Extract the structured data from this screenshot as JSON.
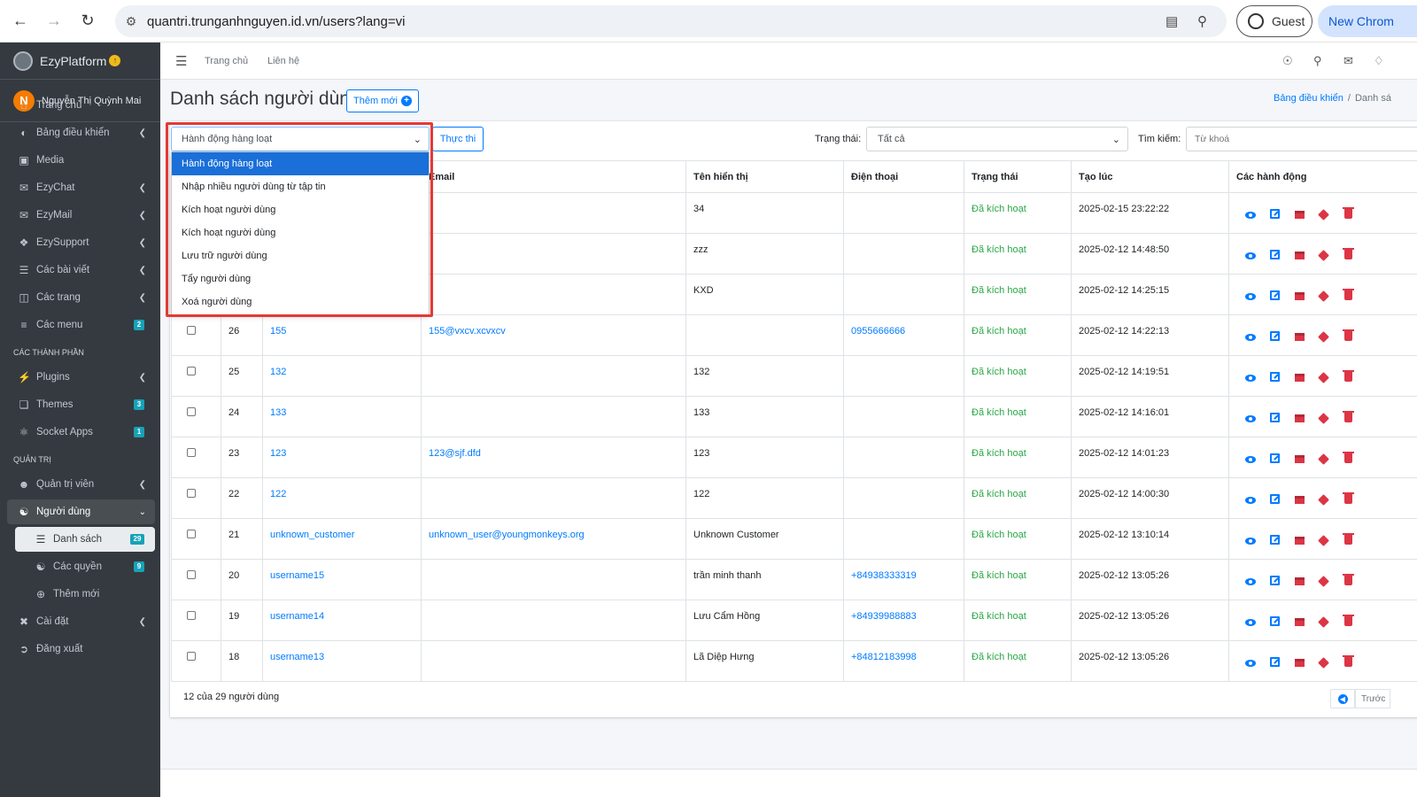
{
  "browser": {
    "url": "quantri.trunganhnguyen.id.vn/users?lang=vi",
    "guest_label": "Guest",
    "new_chrome_label": "New Chrom"
  },
  "sidebar": {
    "brand": "EzyPlatform",
    "user_initial": "N",
    "user_name": "Nguyễn Thị Quỳnh Mai",
    "items": [
      {
        "label": "Trang chủ",
        "icon": "home-icon"
      },
      {
        "label": "Bảng điều khiển",
        "icon": "dashboard-icon"
      },
      {
        "label": "Media",
        "icon": "media-icon"
      },
      {
        "label": "EzyChat",
        "icon": "chat-icon"
      },
      {
        "label": "EzyMail",
        "icon": "mail-icon"
      },
      {
        "label": "EzySupport",
        "icon": "support-icon"
      },
      {
        "label": "Các bài viết",
        "icon": "posts-icon"
      },
      {
        "label": "Các trang",
        "icon": "pages-icon"
      },
      {
        "label": "Các menu",
        "icon": "menu-icon",
        "badge": "2"
      }
    ],
    "header_components": "CÁC THÀNH PHẦN",
    "components": [
      {
        "label": "Plugins",
        "icon": "plugin-icon"
      },
      {
        "label": "Themes",
        "icon": "theme-icon",
        "badge": "3"
      },
      {
        "label": "Socket Apps",
        "icon": "socket-icon",
        "badge": "1"
      }
    ],
    "header_admin": "QUẢN TRỊ",
    "admin": [
      {
        "label": "Quản trị viên",
        "icon": "admin-icon"
      },
      {
        "label": "Người dùng",
        "icon": "users-icon"
      },
      {
        "label": "Danh sách",
        "icon": "list-icon",
        "badge": "29"
      },
      {
        "label": "Các quyền",
        "icon": "roles-icon",
        "badge": "9"
      },
      {
        "label": "Thêm mới",
        "icon": "plus-circle-icon"
      },
      {
        "label": "Cài đặt",
        "icon": "settings-icon"
      },
      {
        "label": "Đăng xuất",
        "icon": "logout-icon"
      }
    ]
  },
  "topnav": {
    "home": "Trang chủ",
    "contact": "Liên hệ"
  },
  "page": {
    "title": "Danh sách người dùng",
    "add_label": "Thêm mới",
    "breadcrumb_1": "Bảng điều khiển",
    "breadcrumb_2": "Danh sá"
  },
  "toolbar": {
    "bulk_value": "Hành động hàng loạt",
    "exec_label": "Thực thi",
    "status_label": "Trạng thái:",
    "status_value": "Tất cả",
    "search_label": "Tìm kiếm:",
    "search_placeholder": "Từ khoá"
  },
  "dropdown": {
    "options": [
      "Hành động hàng loạt",
      "Nhập nhiều người dùng từ tập tin",
      "Kích hoạt người dùng",
      "Kích hoạt người dùng",
      "Lưu trữ người dùng",
      "Tẩy người dùng",
      "Xoá người dùng"
    ]
  },
  "table": {
    "headers": [
      "",
      "",
      "",
      "Email",
      "Tên hiển thị",
      "Điện thoại",
      "Trạng thái",
      "Tạo lúc",
      "Các hành động"
    ],
    "rows": [
      {
        "id": "",
        "username": "",
        "email": "",
        "display": "34",
        "phone": "",
        "status": "Đã kích hoạt",
        "created": "2025-02-15 23:22:22"
      },
      {
        "id": "",
        "username": "",
        "email": "",
        "display": "zzz",
        "phone": "",
        "status": "Đã kích hoạt",
        "created": "2025-02-12 14:48:50"
      },
      {
        "id": "",
        "username": "",
        "email": "",
        "display": "KXD",
        "phone": "",
        "status": "Đã kích hoạt",
        "created": "2025-02-12 14:25:15"
      },
      {
        "id": "26",
        "username": "155",
        "email": "155@vxcv.xcvxcv",
        "display": "",
        "phone": "0955666666",
        "status": "Đã kích hoạt",
        "created": "2025-02-12 14:22:13"
      },
      {
        "id": "25",
        "username": "132",
        "email": "",
        "display": "132",
        "phone": "",
        "status": "Đã kích hoạt",
        "created": "2025-02-12 14:19:51"
      },
      {
        "id": "24",
        "username": "133",
        "email": "",
        "display": "133",
        "phone": "",
        "status": "Đã kích hoạt",
        "created": "2025-02-12 14:16:01"
      },
      {
        "id": "23",
        "username": "123",
        "email": "123@sjf.dfd",
        "display": "123",
        "phone": "",
        "status": "Đã kích hoạt",
        "created": "2025-02-12 14:01:23"
      },
      {
        "id": "22",
        "username": "122",
        "email": "",
        "display": "122",
        "phone": "",
        "status": "Đã kích hoạt",
        "created": "2025-02-12 14:00:30"
      },
      {
        "id": "21",
        "username": "unknown_customer",
        "email": "unknown_user@youngmonkeys.org",
        "display": "Unknown Customer",
        "phone": "",
        "status": "Đã kích hoạt",
        "created": "2025-02-12 13:10:14"
      },
      {
        "id": "20",
        "username": "username15",
        "email": "",
        "display": "trần minh thanh",
        "phone": "+84938333319",
        "status": "Đã kích hoạt",
        "created": "2025-02-12 13:05:26"
      },
      {
        "id": "19",
        "username": "username14",
        "email": "",
        "display": "Lưu Cẩm Hồng",
        "phone": "+84939988883",
        "status": "Đã kích hoạt",
        "created": "2025-02-12 13:05:26"
      },
      {
        "id": "18",
        "username": "username13",
        "email": "",
        "display": "Lã Diệp Hưng",
        "phone": "+84812183998",
        "status": "Đã kích hoạt",
        "created": "2025-02-12 13:05:26"
      }
    ]
  },
  "footer": {
    "count": "12 của 29 người dùng",
    "prev_label": "Trước"
  }
}
